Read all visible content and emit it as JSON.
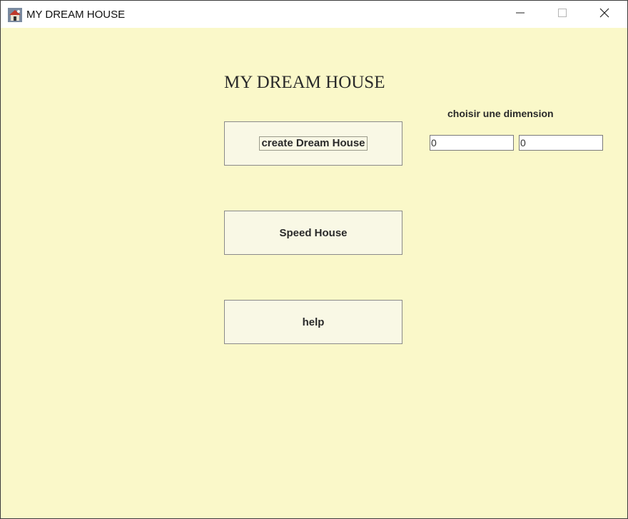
{
  "window": {
    "title": "MY DREAM HOUSE",
    "icon": "house-app-icon"
  },
  "titlebar_controls": {
    "minimize_icon": "minimize-icon",
    "maximize_icon": "maximize-icon",
    "close_icon": "close-icon"
  },
  "main": {
    "title": "MY DREAM HOUSE",
    "buttons": [
      {
        "label": "create Dream House"
      },
      {
        "label": "Speed House"
      },
      {
        "label": "help"
      }
    ]
  },
  "dimension": {
    "label": "choisir une dimension",
    "width_value": "0",
    "height_value": "0"
  },
  "colors": {
    "background": "#faf8c9",
    "button_background": "#f9f8e5",
    "text": "#2a2a2a"
  }
}
